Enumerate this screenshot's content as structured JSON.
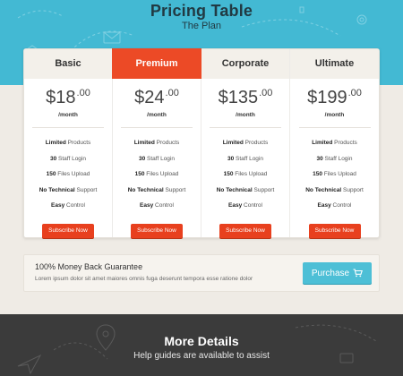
{
  "header": {
    "title": "Pricing Table",
    "subtitle": "The Plan"
  },
  "colors": {
    "header_bg": "#43b9d3",
    "accent": "#ec4a26",
    "button": "#e8401e",
    "purchase_button": "#4dbfd6",
    "footer_bg": "#3b3b3b"
  },
  "plans": [
    {
      "name": "Basic",
      "featured": false,
      "price_main": "$18",
      "price_cents": ".00",
      "period": "/month",
      "features": [
        {
          "bold": "Limited",
          "text": " Products"
        },
        {
          "bold": "30",
          "text": " Staff Login"
        },
        {
          "bold": "150",
          "text": " Files Upload"
        },
        {
          "bold": "No Technical",
          "text": " Support"
        },
        {
          "bold": "Easy",
          "text": " Control"
        }
      ],
      "button_label": "Subscribe Now"
    },
    {
      "name": "Premium",
      "featured": true,
      "price_main": "$24",
      "price_cents": ".00",
      "period": "/month",
      "features": [
        {
          "bold": "Limited",
          "text": " Products"
        },
        {
          "bold": "30",
          "text": " Staff Login"
        },
        {
          "bold": "150",
          "text": " Files Upload"
        },
        {
          "bold": "No Technical",
          "text": " Support"
        },
        {
          "bold": "Easy",
          "text": " Control"
        }
      ],
      "button_label": "Subscribe Now"
    },
    {
      "name": "Corporate",
      "featured": false,
      "price_main": "$135",
      "price_cents": ".00",
      "period": "/month",
      "features": [
        {
          "bold": "Limited",
          "text": " Products"
        },
        {
          "bold": "30",
          "text": " Staff Login"
        },
        {
          "bold": "150",
          "text": " Files Upload"
        },
        {
          "bold": "No Technical",
          "text": " Support"
        },
        {
          "bold": "Easy",
          "text": " Control"
        }
      ],
      "button_label": "Subscribe Now"
    },
    {
      "name": "Ultimate",
      "featured": false,
      "price_main": "$199",
      "price_cents": ".00",
      "period": "/month",
      "features": [
        {
          "bold": "Limited",
          "text": " Products"
        },
        {
          "bold": "30",
          "text": " Staff Login"
        },
        {
          "bold": "150",
          "text": " Files Upload"
        },
        {
          "bold": "No Technical",
          "text": " Support"
        },
        {
          "bold": "Easy",
          "text": " Control"
        }
      ],
      "button_label": "Subscribe Now"
    }
  ],
  "guarantee": {
    "title": "100% Money Back Guarantee",
    "text": "Lorem ipsum dolor sit amet maiores omnis fuga deserunt tempora esse ratione dolor",
    "button_label": "Purchase",
    "button_icon": "cart-icon"
  },
  "footer": {
    "title": "More Details",
    "subtitle": "Help guides are available to assist"
  }
}
